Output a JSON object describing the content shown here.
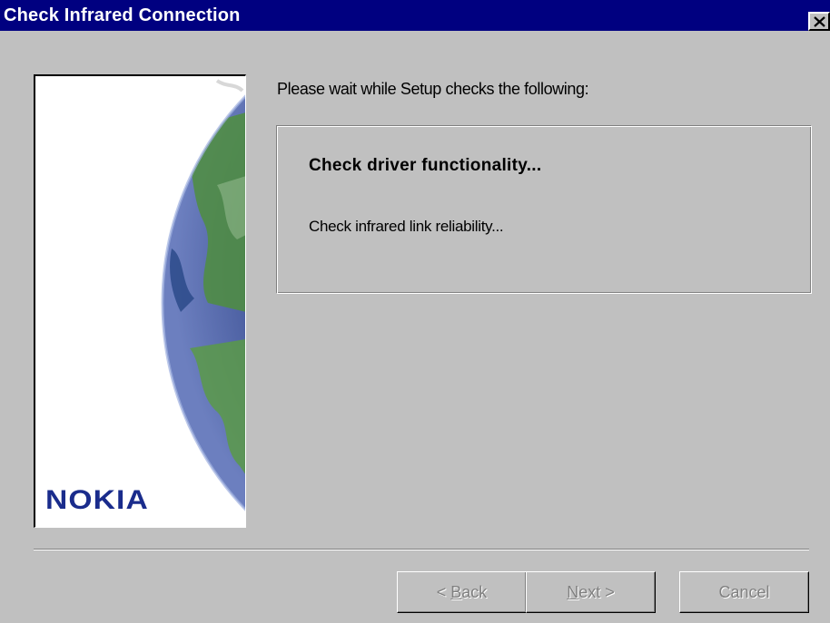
{
  "window": {
    "title": "Check Infrared Connection",
    "close_icon": "close-icon"
  },
  "side_panel": {
    "image": "globe-image",
    "logo_text": "NOKIA",
    "logo_color": "#1a2c8c"
  },
  "main": {
    "instruction": "Please wait while Setup checks the following:",
    "checks": [
      {
        "label": "Check driver functionality...",
        "state": "active"
      },
      {
        "label": "Check infrared link reliability...",
        "state": "pending"
      }
    ]
  },
  "buttons": {
    "back": {
      "prefix": "< ",
      "mnemonic": "B",
      "rest": "ack",
      "enabled": false
    },
    "next": {
      "prefix": "",
      "mnemonic": "N",
      "rest": "ext >",
      "enabled": false
    },
    "cancel": {
      "label": "Cancel",
      "enabled": false
    }
  },
  "colors": {
    "titlebar": "#000080",
    "face": "#c0c0c0",
    "disabled_text": "#808080"
  }
}
